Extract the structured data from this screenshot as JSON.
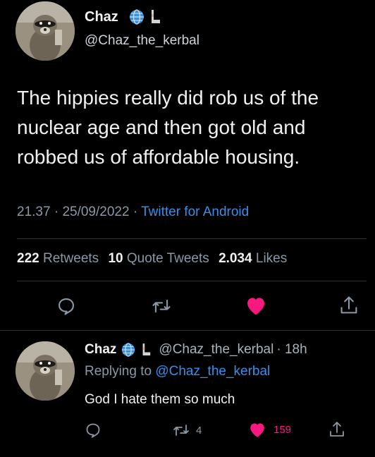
{
  "tweet": {
    "author_name": "Chaz",
    "handle": "@Chaz_the_kerbal",
    "text_lines": [
      "The hippies really did rob us of the",
      "nuclear age and then got old and",
      "robbed us of affordable housing."
    ],
    "time": "21.37",
    "date": "25/09/2022",
    "separator": "·",
    "source": "Twitter for Android",
    "stats": {
      "retweets_count": "222",
      "retweets_label": "Retweets",
      "quotes_count": "10",
      "quotes_label": "Quote Tweets",
      "likes_count": "2.034",
      "likes_label": "Likes"
    }
  },
  "reply": {
    "author_name": "Chaz",
    "handle": "@Chaz_the_kerbal",
    "age": "· 18h",
    "replying_prefix": "Replying to",
    "replying_handle": "@Chaz_the_kerbal",
    "text": "God I hate them so much",
    "retweet_count": "4",
    "like_count": "159"
  },
  "colors": {
    "background": "#000000",
    "accent_blue": "#3a8ee6",
    "like_pink": "#f91880",
    "muted": "#8b98a5"
  },
  "icons": [
    "globe-icon",
    "rocket-icon",
    "reply-icon",
    "retweet-icon",
    "heart-icon",
    "share-icon"
  ]
}
